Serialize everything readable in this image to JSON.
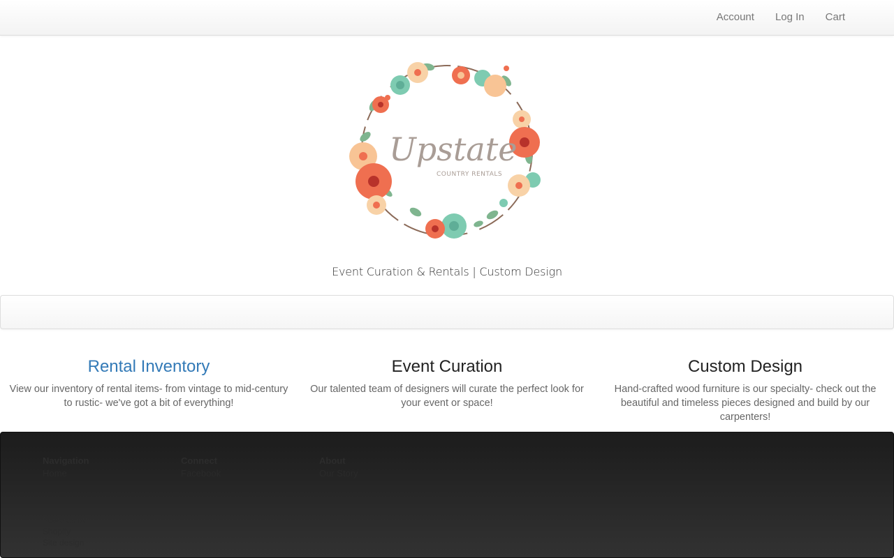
{
  "topnav": {
    "items": [
      {
        "label": "Account"
      },
      {
        "label": "Log In"
      },
      {
        "label": "Cart"
      }
    ]
  },
  "brand": {
    "logo_text": "Upstate",
    "logo_subtext": "COUNTRY RENTALS",
    "tagline": "Event Curation & Rentals | Custom Design"
  },
  "features": [
    {
      "title": "Rental Inventory",
      "text": "View our inventory of rental items- from vintage to mid-century to rustic- we've got a bit of everything!"
    },
    {
      "title": "Event Curation",
      "text": "Our talented team of designers will curate the perfect look for your event or space!"
    },
    {
      "title": "Custom Design",
      "text": "Hand-crafted wood furniture is our specialty- check out the beautiful and timeless pieces designed and build by our carpenters!"
    }
  ],
  "footer": {
    "columns": [
      {
        "heading": "Navigation",
        "link": "Home"
      },
      {
        "heading": "Connect",
        "link": "Facebook"
      },
      {
        "heading": "About",
        "link": "Our Story"
      }
    ],
    "lower_lines": [
      "Powered by",
      "Shopify",
      "Site design"
    ]
  },
  "colors": {
    "link": "#337ab7",
    "footer_bg": "#262626",
    "coral": "#ef6f50",
    "peach": "#f8c495",
    "mint": "#7ecbb1"
  }
}
